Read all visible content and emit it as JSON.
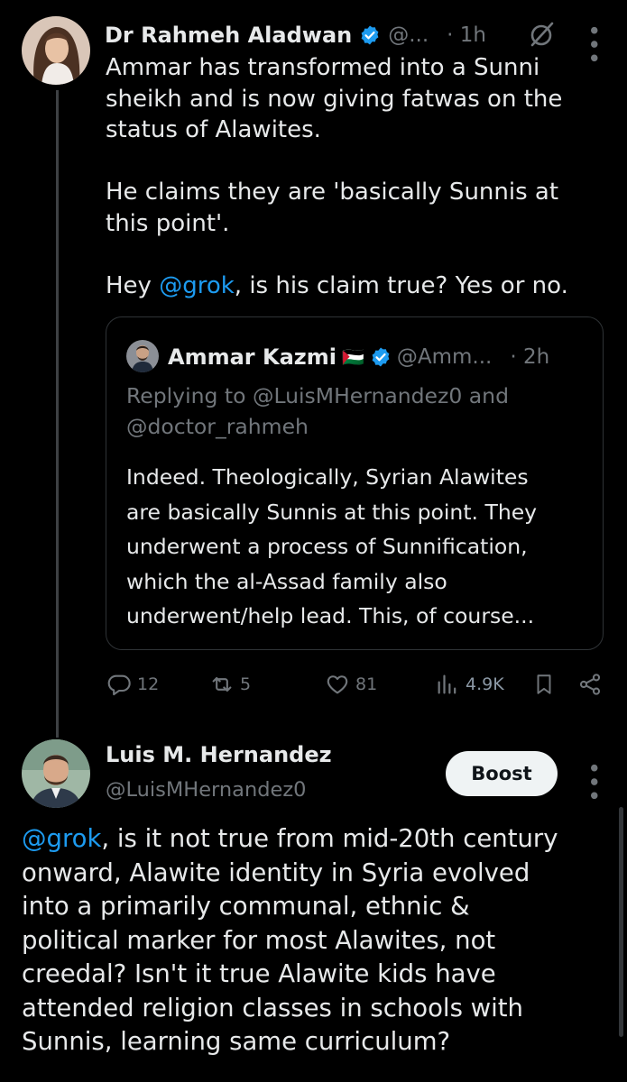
{
  "tweet1": {
    "author_name": "Dr Rahmeh Aladwan",
    "handle": "@...",
    "time": "· 1h",
    "paragraphs": [
      {
        "lines": [
          "Ammar has transformed into a Sunni",
          "sheikh and is now giving fatwas on the",
          "status of Alawites."
        ]
      },
      {
        "lines": [
          "He claims they are 'basically Sunnis at",
          "this point'."
        ]
      }
    ],
    "last_line_prefix": "Hey ",
    "last_line_mention": "@grok",
    "last_line_suffix": ", is his claim true? Yes or no.",
    "quote": {
      "author_name": "Ammar Kazmi",
      "flag": "🇵🇸",
      "handle": "@Amm...",
      "time": "· 2h",
      "replying_line1": "Replying to @LuisMHernandez0 and",
      "replying_line2": "@doctor_rahmeh",
      "text_lines": [
        "Indeed. Theologically, Syrian Alawites",
        "are basically Sunnis at this point. They",
        "underwent a process of Sunnification,",
        "which the al-Assad family also",
        "underwent/help lead. This, of course..."
      ]
    },
    "actions": {
      "replies": "12",
      "reposts": "5",
      "likes": "81",
      "views": "4.9K"
    }
  },
  "tweet2": {
    "author_name": "Luis M. Hernandez",
    "handle": "@LuisMHernandez0",
    "boost_label": "Boost",
    "mention": "@grok",
    "first_line_suffix": ", is it not true from mid-20th century",
    "lines": [
      "onward, Alawite identity in Syria evolved",
      "into a primarily communal, ethnic &",
      "political marker for most Alawites, not",
      "creedal? Isn't it true Alawite kids have",
      "attended religion classes in schools with",
      "Sunnis, learning same curriculum?"
    ]
  },
  "colors": {
    "background": "#000000",
    "text": "#e7e9ea",
    "muted": "#71767b",
    "accent": "#1d9bf0",
    "border": "#2f3336"
  }
}
